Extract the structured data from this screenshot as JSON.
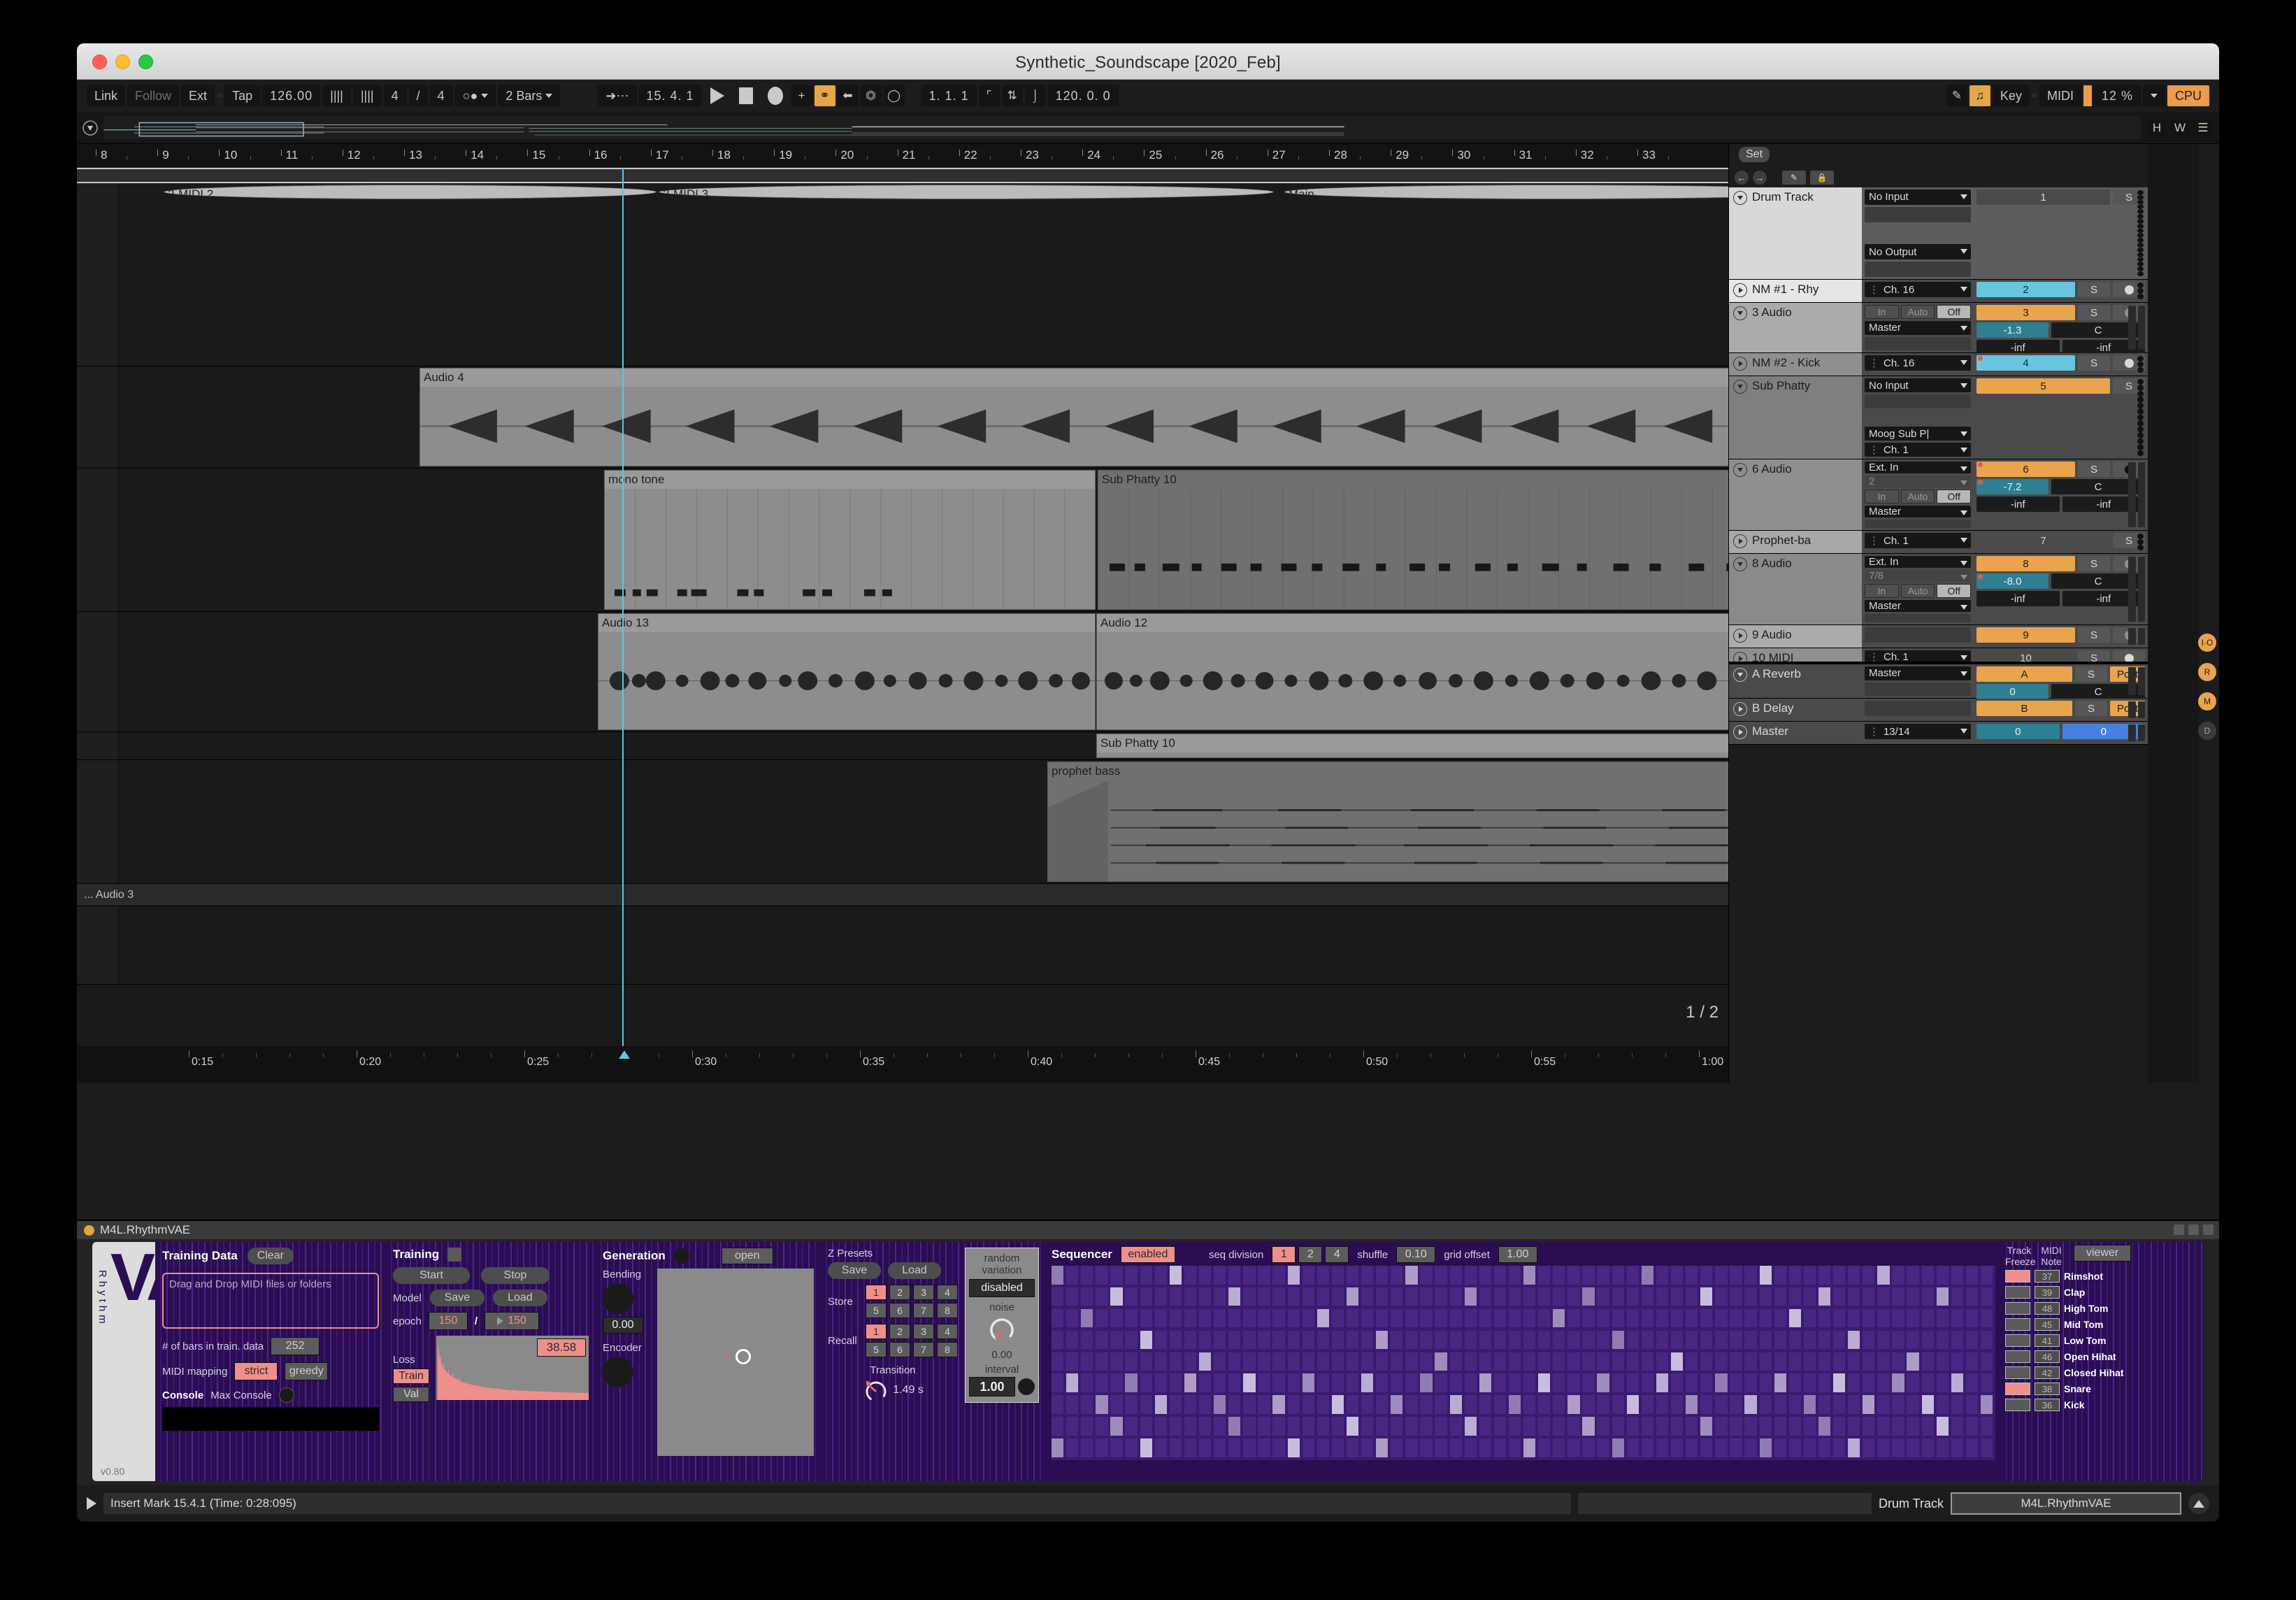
{
  "window": {
    "title": "Synthetic_Soundscape  [2020_Feb]"
  },
  "controlbar": {
    "link": "Link",
    "follow": "Follow",
    "ext": "Ext",
    "tap": "Tap",
    "tempo": "126.00",
    "sig_num": "4",
    "sig_sep": "/",
    "sig_den": "4",
    "quantize": "2 Bars",
    "position": "15. 4. 1",
    "loop_start": "1. 1. 1",
    "loop_length": "120. 0. 0",
    "key": "Key",
    "midi": "MIDI",
    "cpu_pct": "12 %",
    "cpu": "CPU"
  },
  "ruler": {
    "bars": [
      "8",
      "9",
      "10",
      "11",
      "12",
      "13",
      "14",
      "15",
      "16",
      "17",
      "18",
      "19",
      "20",
      "21",
      "22",
      "23",
      "24",
      "25",
      "26",
      "27",
      "28",
      "29",
      "30",
      "31",
      "32",
      "33"
    ],
    "times": [
      "0:15",
      "0:20",
      "0:25",
      "0:30",
      "0:35",
      "0:40",
      "0:45",
      "0:50",
      "0:55",
      "1:00"
    ]
  },
  "arrangement": {
    "page_indicator": "1 / 2",
    "bottom_track_label": "... Audio 3",
    "clips": [
      {
        "name": "2-MIDI 2"
      },
      {
        "name": "2-MIDI 3"
      },
      {
        "name": "Main"
      },
      {
        "name": "Audio 4"
      },
      {
        "name": "mono tone"
      },
      {
        "name": "Sub Phatty 10"
      },
      {
        "name": "Audio 13"
      },
      {
        "name": "Audio 12"
      },
      {
        "name": "Sub Phatty 10"
      },
      {
        "name": "prophet bass"
      }
    ]
  },
  "tracklist": {
    "set_button": "Set",
    "tracks": [
      {
        "name": "Drum Track",
        "input": "No Input",
        "output": "No Output",
        "num": "1",
        "solo": "S"
      },
      {
        "name": "NM #1 - Rhy",
        "input": "Ch. 16",
        "num": "2",
        "solo": "S"
      },
      {
        "name": "3 Audio",
        "in": "In",
        "auto": "Auto",
        "off": "Off",
        "output": "Master",
        "num": "3",
        "solo": "S",
        "vol": "-1.3",
        "pan": "C",
        "peak_l": "-inf",
        "peak_r": "-inf"
      },
      {
        "name": "NM #2 - Kick",
        "input": "Ch. 16",
        "num": "4",
        "solo": "S"
      },
      {
        "name": "Sub Phatty",
        "input": "No Input",
        "device": "Moog Sub P|",
        "chan": "Ch. 1",
        "num": "5",
        "solo": "S"
      },
      {
        "name": "6 Audio",
        "input": "Ext. In",
        "sub": "2",
        "in": "In",
        "auto": "Auto",
        "off": "Off",
        "output": "Master",
        "num": "6",
        "solo": "S",
        "vol": "-7.2",
        "pan": "C",
        "peak_l": "-inf",
        "peak_r": "-inf"
      },
      {
        "name": "Prophet-ba",
        "input": "Ch. 1",
        "num": "7",
        "solo": "S"
      },
      {
        "name": "8 Audio",
        "input": "Ext. In",
        "sub": "7/8",
        "in": "In",
        "auto": "Auto",
        "off": "Off",
        "output": "Master",
        "num": "8",
        "solo": "S",
        "vol": "-8.0",
        "pan": "C",
        "peak_l": "-inf",
        "peak_r": "-inf"
      },
      {
        "name": "9 Audio",
        "num": "9",
        "solo": "S"
      },
      {
        "name": "10 MIDI",
        "input": "Ch. 1",
        "num": "10",
        "solo": "S"
      },
      {
        "name": "A Reverb",
        "output": "Master",
        "num": "A",
        "solo": "S",
        "post": "Post",
        "vol": "0",
        "pan": "C"
      },
      {
        "name": "B Delay",
        "num": "B",
        "solo": "S",
        "post": "Post"
      },
      {
        "name": "Master",
        "input": "13/14",
        "num": "0",
        "cue": "0"
      }
    ]
  },
  "device": {
    "title": "M4L.RhythmVAE",
    "logo_word": "Rhythm",
    "logo_mark": "VAE",
    "version": "v0.80",
    "training_data": {
      "heading": "Training Data",
      "clear": "Clear",
      "dropzone": "Drag and Drop MIDI files or folders",
      "bars_label": "# of bars in train. data",
      "bars_value": "252",
      "mapping_label": "MIDI mapping",
      "mapping_strict": "strict",
      "mapping_greedy": "greedy",
      "console_label": "Console",
      "max_console": "Max Console"
    },
    "training": {
      "heading": "Training",
      "start": "Start",
      "stop": "Stop",
      "model_label": "Model",
      "save": "Save",
      "load": "Load",
      "epoch_label": "epoch",
      "epoch_current": "150",
      "epoch_sep": "/",
      "epoch_total": "150",
      "loss_value": "38.58",
      "loss_label": "Loss",
      "loss_train": "Train",
      "loss_val": "Val"
    },
    "generation": {
      "heading": "Generation",
      "open": "open",
      "bending_label": "Bending",
      "bending_value": "0.00",
      "encoder_label": "Encoder",
      "z_marker": "z"
    },
    "z_presets": {
      "heading": "Z Presets",
      "save": "Save",
      "load": "Load",
      "store_label": "Store",
      "recall_label": "Recall",
      "slots": [
        "1",
        "2",
        "3",
        "4",
        "5",
        "6",
        "7",
        "8"
      ],
      "store_active": "1",
      "recall_active": "1",
      "transition_label": "Transition",
      "transition_value": "1.49 s"
    },
    "random_variation": {
      "heading_line1": "random",
      "heading_line2": "variation",
      "state": "disabled",
      "noise_label": "noise",
      "noise_value": "0.00",
      "interval_label": "interval",
      "interval_value": "1.00"
    },
    "sequencer": {
      "heading": "Sequencer",
      "enabled": "enabled",
      "seq_division_label": "seq division",
      "divisions": [
        "1",
        "2",
        "4"
      ],
      "division_active": "1",
      "shuffle_label": "shuffle",
      "shuffle_value": "0.10",
      "grid_offset_label": "grid offset",
      "grid_offset_value": "1.00"
    },
    "right_panel": {
      "track_freeze_l1": "Track",
      "track_freeze_l2": "Freeze",
      "midi_note_l1": "MIDI",
      "midi_note_l2": "Note",
      "viewer": "viewer",
      "rows": [
        {
          "note": "37",
          "name": "Rimshot",
          "frozen": true
        },
        {
          "note": "39",
          "name": "Clap",
          "frozen": false
        },
        {
          "note": "48",
          "name": "High Tom",
          "frozen": false
        },
        {
          "note": "45",
          "name": "Mid Tom",
          "frozen": false
        },
        {
          "note": "41",
          "name": "Low Tom",
          "frozen": false
        },
        {
          "note": "46",
          "name": "Open Hihat",
          "frozen": false
        },
        {
          "note": "42",
          "name": "Closed Hihat",
          "frozen": false
        },
        {
          "note": "38",
          "name": "Snare",
          "frozen": true
        },
        {
          "note": "36",
          "name": "Kick",
          "frozen": false
        }
      ]
    }
  },
  "statusbar": {
    "message": "Insert Mark 15.4.1 (Time: 0:28:095)",
    "track_label": "Drum Track",
    "device_label": "M4L.RhythmVAE"
  },
  "colors": {
    "accent_orange": "#eaa44d",
    "accent_cyan": "#67c5e0",
    "accent_teal": "#2e7f92",
    "accent_pink": "#ef8f8b",
    "device_bg": "#2a0d52"
  }
}
